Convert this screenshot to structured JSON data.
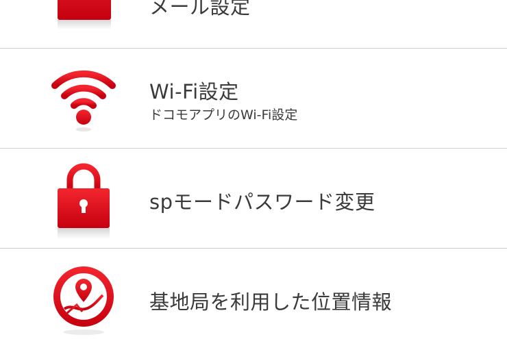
{
  "settings_list": {
    "items": [
      {
        "id": "mail",
        "label": "メール設定",
        "sublabel": "",
        "icon": "envelope-icon"
      },
      {
        "id": "wifi",
        "label": "Wi-Fi設定",
        "sublabel": "ドコモアプリのWi-Fi設定",
        "icon": "wifi-icon"
      },
      {
        "id": "password",
        "label": "spモードパスワード変更",
        "sublabel": "",
        "icon": "lock-icon"
      },
      {
        "id": "location",
        "label": "基地局を利用した位置情報",
        "sublabel": "",
        "icon": "location-pin-icon"
      }
    ]
  },
  "colors": {
    "accent_red": "#e0001b",
    "accent_red_dark": "#b00015",
    "text": "#3a3a3a",
    "divider": "#cfcfcf",
    "background": "#ffffff"
  }
}
